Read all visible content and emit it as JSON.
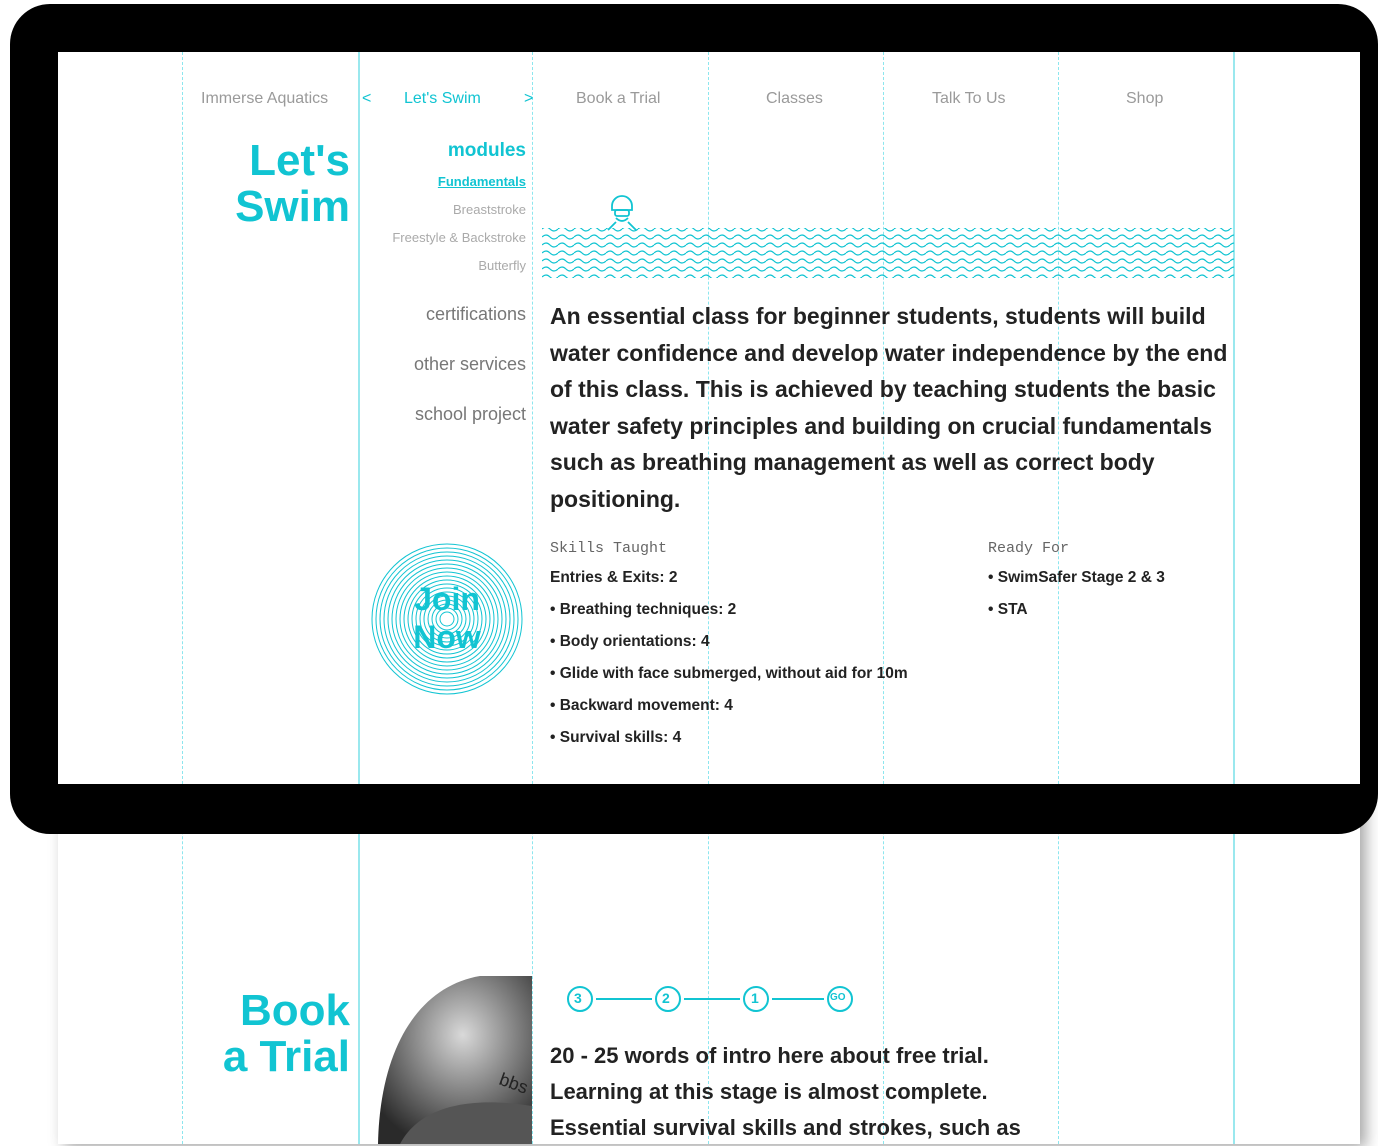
{
  "nav": {
    "brand": "Immerse Aquatics",
    "prev_arrow": "<",
    "active": "Let's Swim",
    "next_arrow": ">",
    "items": [
      "Book a Trial",
      "Classes",
      "Talk To Us",
      "Shop"
    ]
  },
  "section": {
    "title_line1": "Let's",
    "title_line2": "Swim"
  },
  "sidebar": {
    "modules_heading": "modules",
    "modules": [
      "Fundamentals",
      "Breaststroke",
      "Freestyle & Backstroke",
      "Butterfly"
    ],
    "links": [
      "certifications",
      "other services",
      "school project"
    ],
    "cta_line1": "Join",
    "cta_line2": "Now"
  },
  "content": {
    "description": "An essential class for beginner students, students will build water confidence and develop water independence by the end of this class. This is achieved by teaching students the basic water safety principles and building on crucial fundamentals such as breathing management as well as correct body positioning.",
    "skills_heading": "Skills Taught",
    "skills": [
      "Entries & Exits: 2",
      "• Breathing techniques: 2",
      "• Body orientations: 4",
      "• Glide with face submerged, without aid for 10m",
      "• Backward movement: 4",
      "• Survival skills: 4"
    ],
    "ready_heading": "Ready For",
    "ready": [
      "• SwimSafer Stage 2 & 3",
      "• STA"
    ]
  },
  "trial": {
    "title_line1": "Book",
    "title_line2": "a Trial",
    "steps": [
      "3",
      "2",
      "1",
      "GO"
    ],
    "intro_lines": [
      "20 - 25 words of intro here about free trial.",
      "Learning at this stage is almost complete.",
      "Essential survival skills and strokes, such as"
    ],
    "cap_text": "bbs"
  },
  "colors": {
    "accent": "#11c4d2",
    "grid": "#8de6ee",
    "muted": "#9a9a9a",
    "frame": "#000000"
  }
}
